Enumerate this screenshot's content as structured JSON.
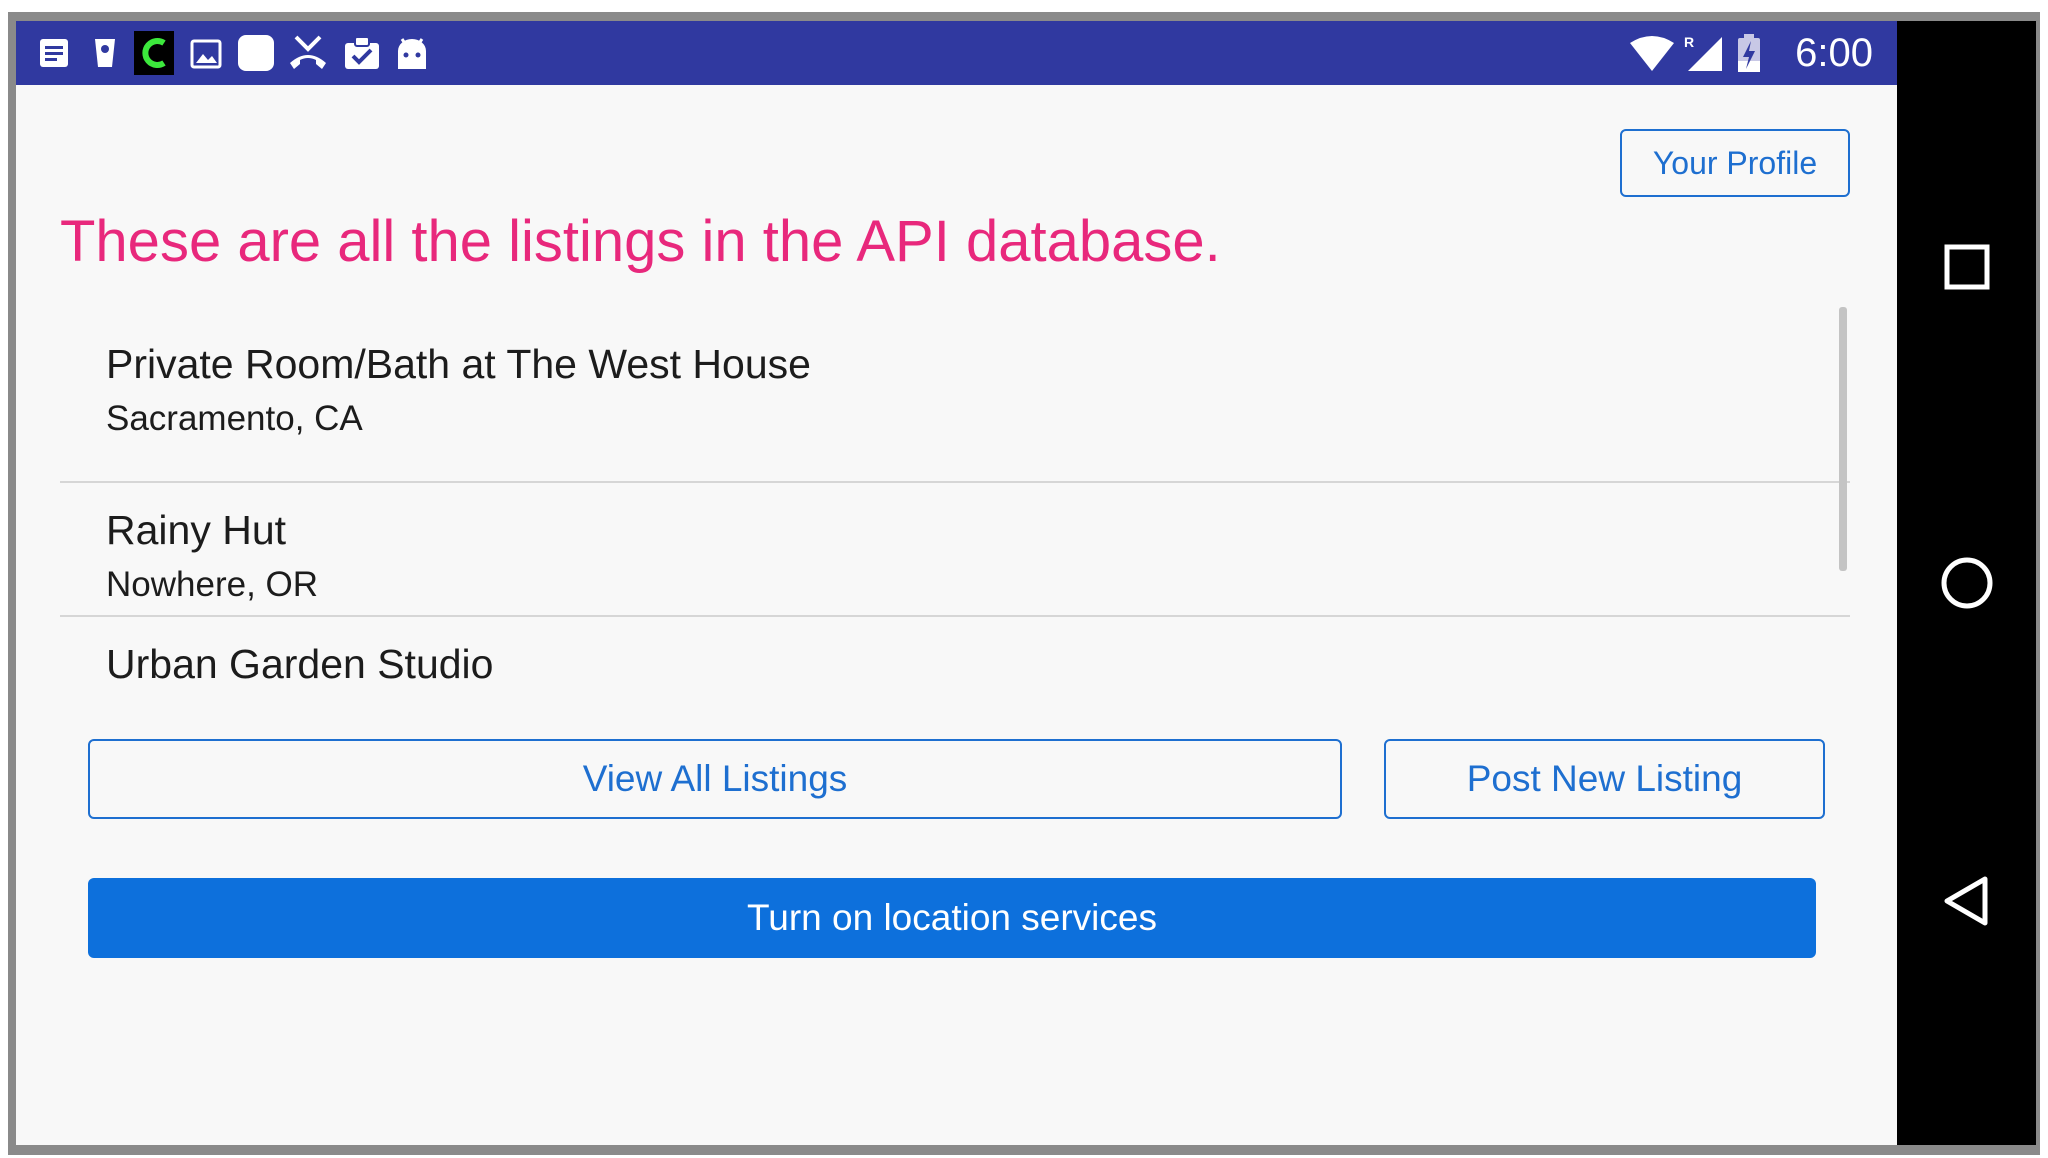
{
  "status_bar": {
    "time": "6:00",
    "notification_icons": [
      "notes-icon",
      "cup-icon",
      "c-app-icon",
      "image-icon",
      "chat-bubble-icon",
      "missed-call-icon",
      "clipboard-check-icon",
      "android-icon"
    ],
    "system_icons": [
      "wifi-icon",
      "roaming-signal-icon",
      "battery-charging-icon"
    ],
    "background_color": "#3039a0"
  },
  "header": {
    "profile_button_label": "Your Profile",
    "heading": "These are all the listings in the API database."
  },
  "listings": [
    {
      "title": "Private Room/Bath at The West House",
      "location": "Sacramento, CA"
    },
    {
      "title": "Rainy Hut",
      "location": "Nowhere, OR"
    },
    {
      "title": "Urban Garden Studio",
      "location": ""
    }
  ],
  "actions": {
    "view_all_label": "View All Listings",
    "post_new_label": "Post New Listing",
    "location_services_label": "Turn on location services"
  },
  "nav_bar": {
    "icons": [
      "recents-square-icon",
      "home-circle-icon",
      "back-triangle-icon"
    ]
  },
  "colors": {
    "heading": "#e8287c",
    "accent_blue": "#1e6fd0",
    "primary_button": "#0d70dc"
  }
}
